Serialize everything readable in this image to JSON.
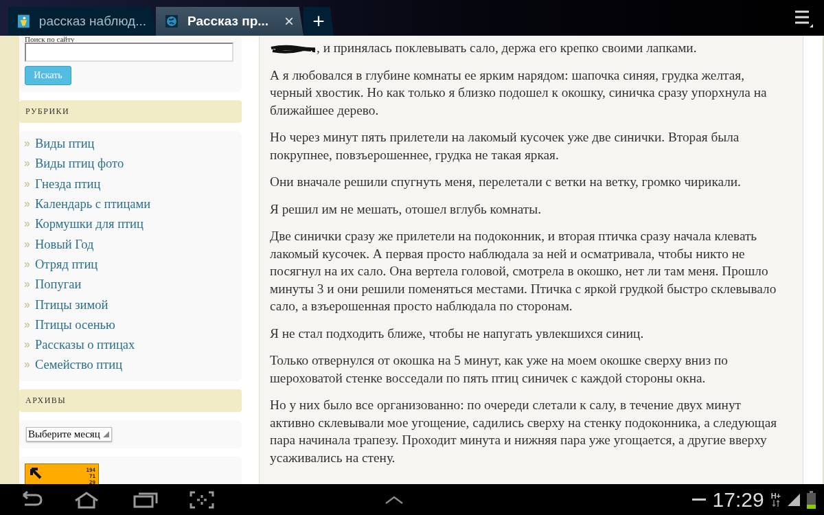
{
  "browser": {
    "tabs": [
      {
        "title": "рассказ наблюд...",
        "selected": false,
        "closable": false
      },
      {
        "title": "Рассказ пр...",
        "selected": true,
        "closable": true
      }
    ],
    "close_label": "×",
    "new_tab_label": "+"
  },
  "sidebar": {
    "search": {
      "label": "Поиск по сайту",
      "button": "Искать"
    },
    "categories": {
      "title": "РУБРИКИ",
      "items": [
        "Виды птиц",
        "Виды птиц фото",
        "Гнезда птиц",
        "Календарь с птицами",
        "Кормушки для птиц",
        "Новый Год",
        "Отряд птиц",
        "Попугаи",
        "Птицы зимой",
        "Птицы осенью",
        "Рассказы о птицах",
        "Семейство птиц"
      ]
    },
    "archives": {
      "title": "АРХИВЫ",
      "select": "Выберите месяц"
    },
    "counter": [
      "194",
      "71",
      "29"
    ]
  },
  "article": {
    "paragraphs": [
      ", и принялась поклевывать сало, держа его крепко своими лапками.",
      "А я любовался в глубине комнаты ее ярким нарядом: шапочка синяя, грудка желтая, черный хвостик. Но как только я близко подошел к окошку, синичка сразу упорхнула на ближайшее дерево.",
      "Но через минут пять прилетели на лакомый кусочек уже две синички. Вторая была покрупнее, повзъерошеннее, грудка не такая яркая.",
      "Они вначале решили спугнуть меня, перелетали с ветки на ветку, громко чирикали.",
      "Я решил им не мешать, отошел вглубь комнаты.",
      "Две синички сразу же прилетели на подоконник, и вторая птичка сразу начала клевать лакомый кусочек. А первая просто наблюдала за ней и осматривала, чтобы никто не посягнул на их сало. Она вертела головой, смотрела в окошко, нет ли там меня. Прошло минуты 3 и они решили поменяться местами. Птичка с яркой грудкой быстро склевывало сало, а взъерошенная просто наблюдала по сторонам.",
      "Я не стал подходить ближе, чтобы не напугать увлекшихся синиц.",
      "Только отвернулся от окошка на 5 минут, как уже на моем окошке сверху вниз по шероховатой стенке восседали по пять птиц синичек с каждой стороны окна.",
      "Но у них было все организованно: по очереди слетали к салу, в течение двух минут активно склевывали мое угощение, садились сверху на стенку подоконника, а следующая пара начинала трапезу. Проходит минута и нижняя пара уже угощается, а другие вверху усаживались на стену."
    ]
  },
  "status_bar": {
    "time": "17:29",
    "network": "H+"
  }
}
